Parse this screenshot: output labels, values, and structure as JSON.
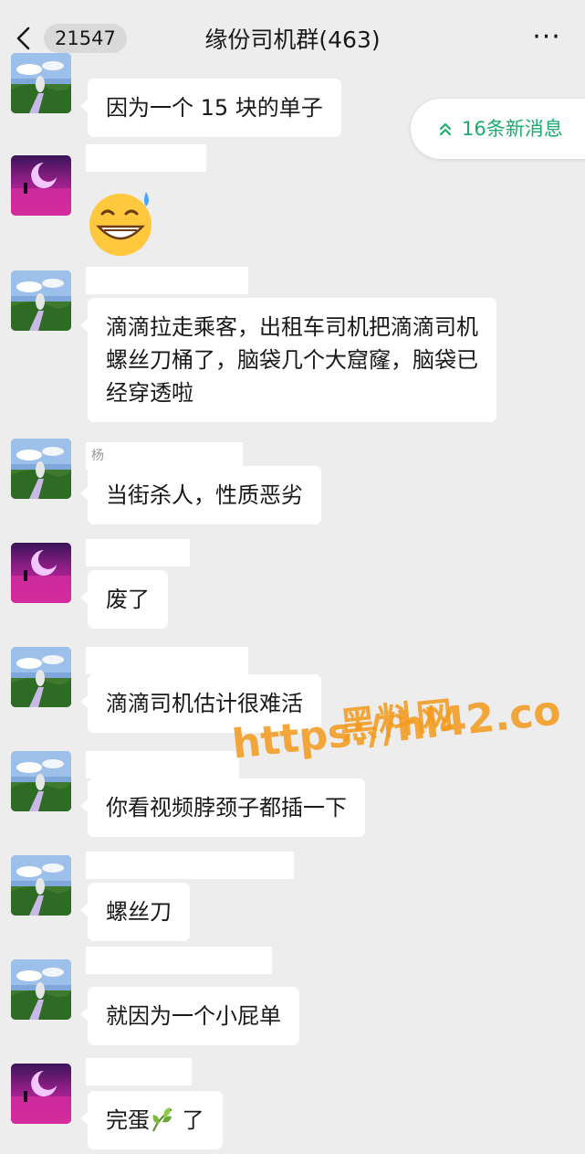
{
  "header": {
    "back_count": "21547",
    "title": "缘份司机群(463)",
    "more_label": "···"
  },
  "new_messages_label": "16条新消息",
  "messages": [
    {
      "avatar": "landscape-avatar",
      "text": "因为一个 15 块的单子"
    },
    {
      "avatar": "purple-sea-avatar",
      "text": "😅"
    },
    {
      "avatar": "landscape-avatar",
      "text": "滴滴拉走乘客，出租车司机把滴滴司机螺丝刀桶了，脑袋几个大窟窿，脑袋已经穿透啦"
    },
    {
      "avatar": "landscape-avatar",
      "nick": "杨",
      "text": "当街杀人，性质恶劣"
    },
    {
      "avatar": "purple-sea-avatar",
      "text": "废了"
    },
    {
      "avatar": "landscape-avatar",
      "text": "滴滴司机估计很难活"
    },
    {
      "avatar": "landscape-avatar",
      "text": "你看视频脖颈子都插一下"
    },
    {
      "avatar": "landscape-avatar",
      "text": "螺丝刀"
    },
    {
      "avatar": "landscape-avatar",
      "text": "就因为一个小屁单"
    },
    {
      "avatar": "purple-sea-avatar",
      "text_before": "完蛋",
      "icon": "leaf-emoji",
      "text_after": " 了"
    }
  ],
  "watermark": {
    "line1": "黑料网",
    "line2": "https://hl42.co"
  },
  "colors": {
    "background": "#ededed",
    "bubble": "#ffffff",
    "accent_green": "#1aad6e",
    "watermark": "#f39a1b"
  }
}
